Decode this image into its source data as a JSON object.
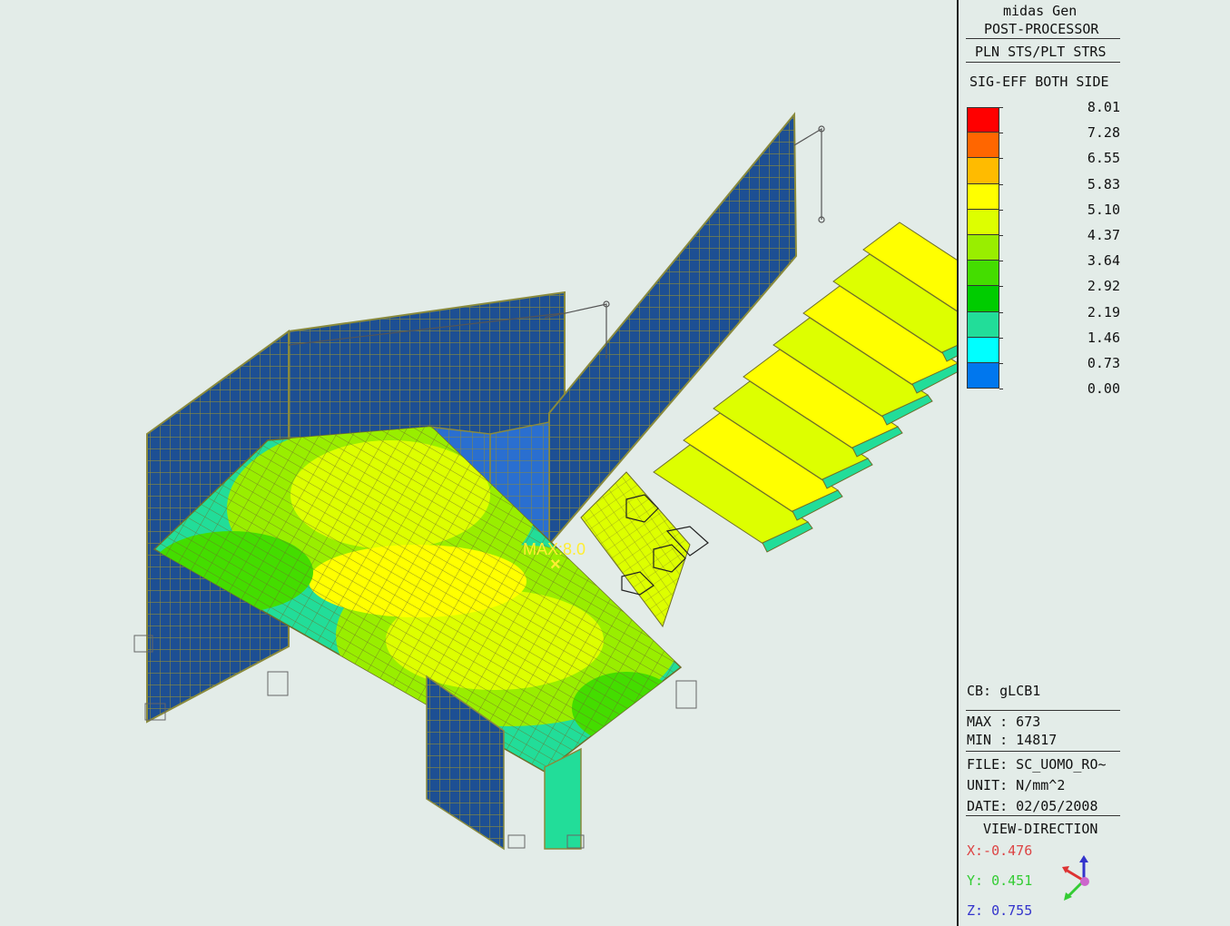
{
  "app": {
    "name": "midas Gen",
    "module": "POST-PROCESSOR"
  },
  "result": {
    "type": "PLN STS/PLT STRS",
    "component": "SIG-EFF BOTH SIDE"
  },
  "legend": {
    "values": [
      "8.01",
      "7.28",
      "6.55",
      "5.83",
      "5.10",
      "4.37",
      "3.64",
      "2.92",
      "2.19",
      "1.46",
      "0.73",
      "0.00"
    ],
    "colors": [
      "#ff0000",
      "#ff6600",
      "#ffbb00",
      "#ffff00",
      "#ddff00",
      "#99ee00",
      "#44dd00",
      "#00cc00",
      "#22dd99",
      "#00ffff",
      "#0077ee"
    ]
  },
  "combination": "CB: gLCB1",
  "max_line": "MAX : 673",
  "min_line": "MIN : 14817",
  "file_line": "FILE: SC_UOMO_RO~",
  "unit_line": "UNIT: N/mm^2",
  "date_line": "DATE: 02/05/2008",
  "view_direction": {
    "title": "VIEW-DIRECTION",
    "x": "X:-0.476",
    "y": "Y: 0.451",
    "z": "Z: 0.755"
  },
  "max_marker": {
    "label": "MAX:8.0",
    "glyph": "×"
  },
  "axis_icon": "axis-triad-icon",
  "colors": {
    "background": "#e3ece8",
    "wall": "#1d4f93",
    "mesh": "#8a8a3c",
    "x_axis": "#dd3333",
    "y_axis": "#33cc33",
    "z_axis": "#3333cc"
  }
}
